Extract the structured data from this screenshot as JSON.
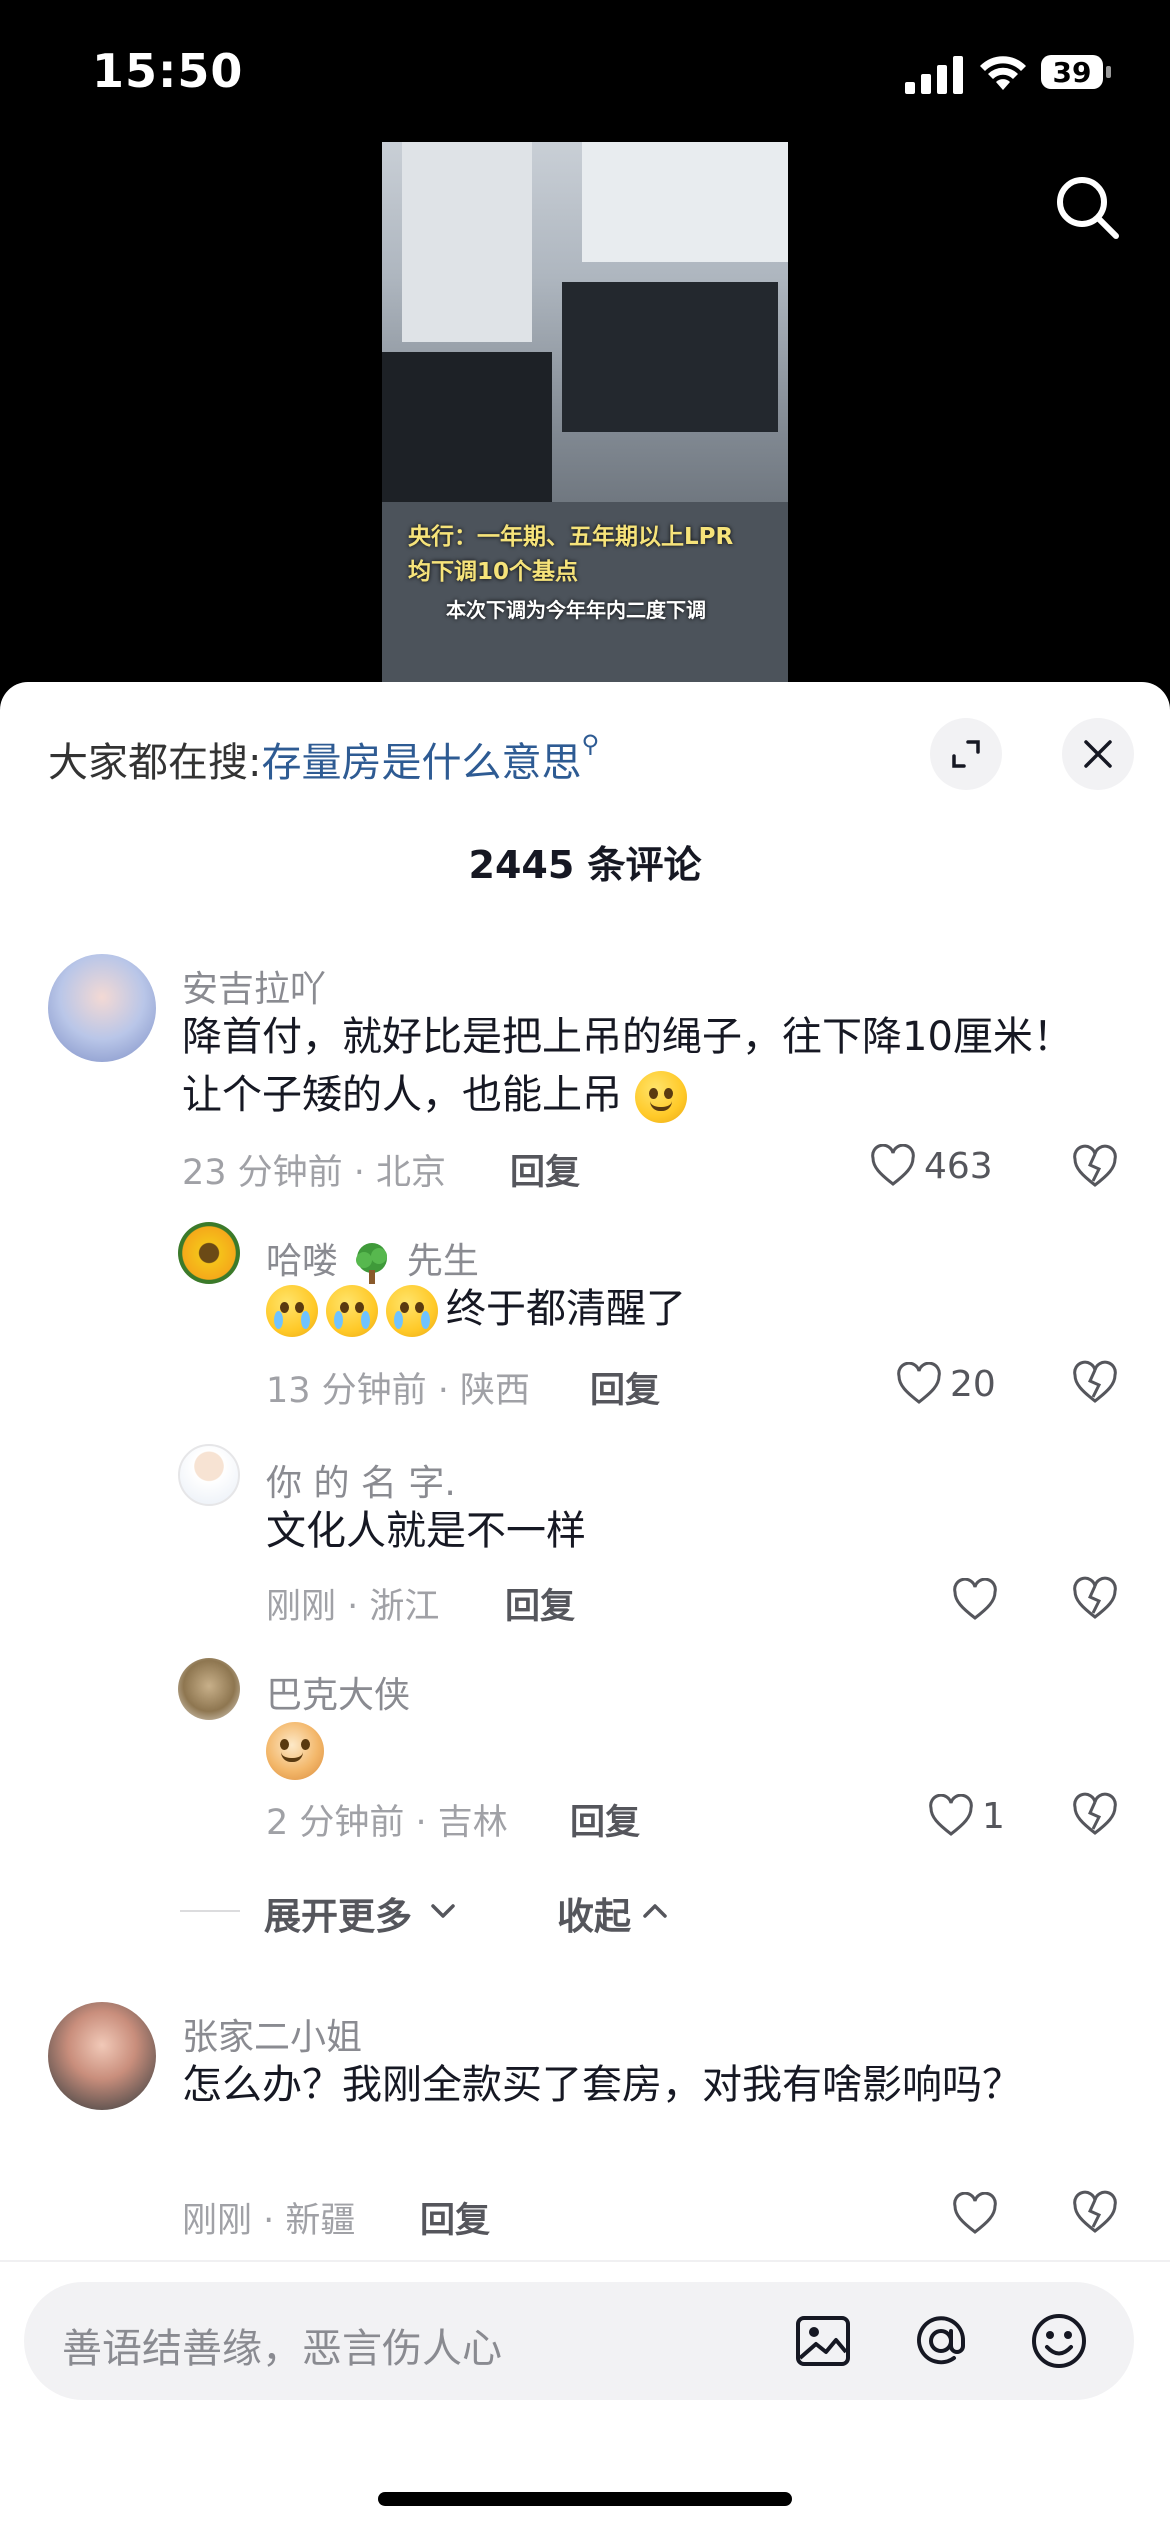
{
  "status_bar": {
    "time": "15:50",
    "battery": "39"
  },
  "video": {
    "caption_line1": "央行：一年期、五年期以上LPR",
    "caption_line2": "均下调10个基点",
    "caption_line3": "本次下调为今年年内二度下调"
  },
  "hot_search": {
    "prefix": "大家都在搜:",
    "query": "存量房是什么意思"
  },
  "comment_count": "2445 条评论",
  "comments": [
    {
      "user": "安吉拉吖",
      "text": "降首付，就好比是把上吊的绳子，往下降10厘米！让个子矮的人，也能上吊",
      "meta": "23 分钟前 · 北京",
      "reply": "回复",
      "likes": "463"
    },
    {
      "user_a": "哈喽",
      "user_b": "先生",
      "text": "终于都清醒了",
      "meta": "13 分钟前 · 陕西",
      "reply": "回复",
      "likes": "20"
    },
    {
      "user": "你 的 名 字.",
      "text": "文化人就是不一样",
      "meta": "刚刚 · 浙江",
      "reply": "回复",
      "likes": ""
    },
    {
      "user": "巴克大侠",
      "text": "",
      "meta": "2 分钟前 · 吉林",
      "reply": "回复",
      "likes": "1"
    },
    {
      "user": "张家二小姐",
      "text": "怎么办？我刚全款买了套房，对我有啥影响吗？",
      "meta": "刚刚 · 新疆",
      "reply": "回复",
      "likes": ""
    }
  ],
  "thread_controls": {
    "expand_more": "展开更多",
    "collapse": "收起"
  },
  "input": {
    "placeholder": "善语结善缘，恶言伤人心"
  },
  "colors": {
    "link": "#2e5b93",
    "sheet_bg": "#ffffff",
    "page_bg": "#000000"
  }
}
